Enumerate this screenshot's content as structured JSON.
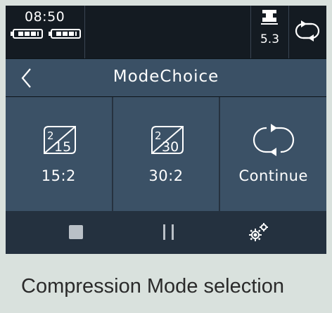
{
  "status_bar": {
    "time": "08:50",
    "batteries": [
      {
        "label": "battery-1"
      },
      {
        "label": "battery-2"
      }
    ],
    "indicator_value": "5.3",
    "indicator_icon": "pressure-gauge-icon",
    "mode_icon": "continuous-cycle-icon"
  },
  "header": {
    "title": "ModeChoice",
    "back_icon": "back-arrow-icon"
  },
  "modes": [
    {
      "label": "15:2",
      "icon": "ratio-2-15-icon",
      "icon_top": "2",
      "icon_bottom": "15"
    },
    {
      "label": "30:2",
      "icon": "ratio-2-30-icon",
      "icon_top": "2",
      "icon_bottom": "30"
    },
    {
      "label": "Continue",
      "icon": "continuous-cycle-icon"
    }
  ],
  "bottom_bar": {
    "stop_icon": "stop-icon",
    "pause_icon": "pause-icon",
    "settings_icon": "gears-icon"
  },
  "caption": "Compression Mode selection",
  "colors": {
    "header_bg": "#3a5065",
    "tile_bg": "#3b5166",
    "bottombar_bg": "#24313f",
    "status_bg": "#141b22",
    "caption_bg": "#d9e1dd"
  }
}
